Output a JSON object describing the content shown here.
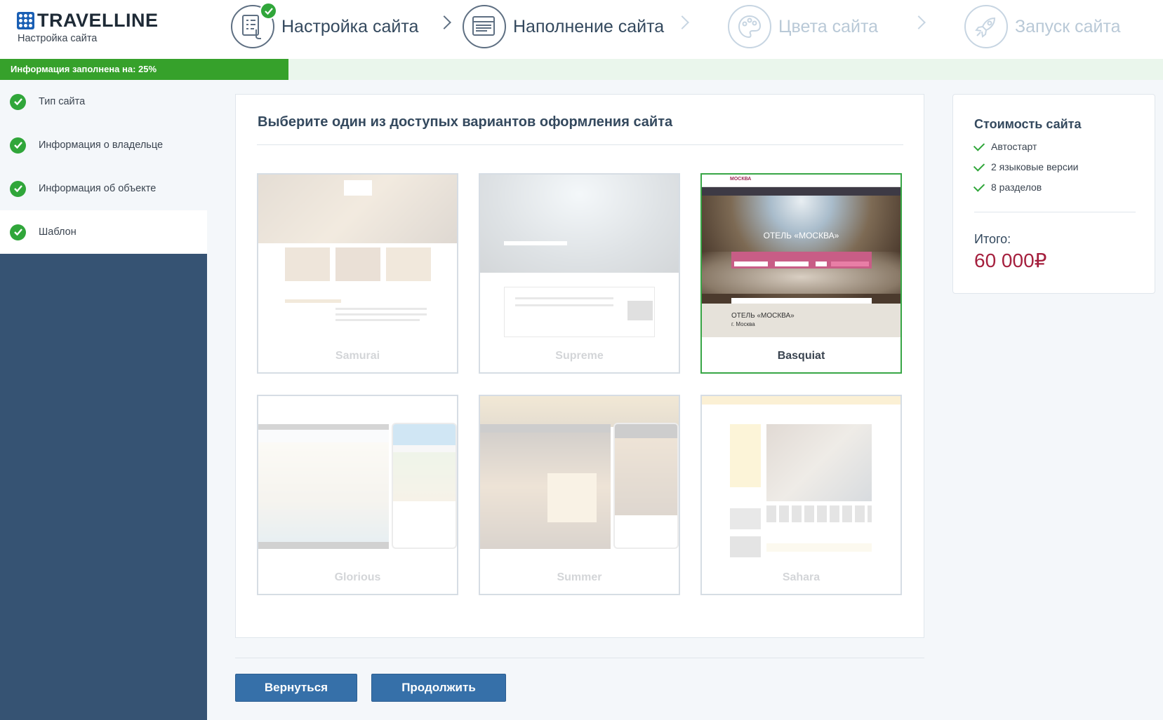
{
  "header": {
    "brand": "TRAVELLINE",
    "subtitle": "Настройка сайта",
    "steps": [
      {
        "label": "Настройка сайта",
        "icon": "checklist-icon",
        "state": "done"
      },
      {
        "label": "Наполнение сайта",
        "icon": "browser-page-icon",
        "state": "active"
      },
      {
        "label": "Цвета сайта",
        "icon": "palette-icon",
        "state": "future"
      },
      {
        "label": "Запуск сайта",
        "icon": "rocket-icon",
        "state": "future"
      }
    ]
  },
  "progress": {
    "label": "Информация заполнена на: 25%",
    "percent": 25,
    "color": "#36a12b"
  },
  "sidebar": {
    "items": [
      {
        "label": "Тип сайта",
        "done": true
      },
      {
        "label": "Информация о владельце",
        "done": true
      },
      {
        "label": "Информация об объекте",
        "done": true
      },
      {
        "label": "Шаблон",
        "done": true,
        "current": true
      }
    ]
  },
  "main": {
    "title": "Выберите один из доступых вариантов оформления сайта",
    "templates": [
      {
        "name": "Samurai",
        "selected": false
      },
      {
        "name": "Supreme",
        "selected": false
      },
      {
        "name": "Basquiat",
        "selected": true,
        "preview": {
          "logo": "МОСКВА",
          "hero_title": "ОТЕЛЬ «МОСКВА»",
          "caption_title": "ОТЕЛЬ «МОСКВА»",
          "caption_city": "г. Москва"
        }
      },
      {
        "name": "Glorious",
        "selected": false
      },
      {
        "name": "Summer",
        "selected": false
      },
      {
        "name": "Sahara",
        "selected": false
      }
    ]
  },
  "summary": {
    "title": "Стоимость сайта",
    "features": [
      "Автостарт",
      "2 языковые версии",
      "8 разделов"
    ],
    "total_label": "Итого:",
    "total_value": "60 000₽"
  },
  "footer": {
    "back_label": "Вернуться",
    "continue_label": "Продолжить"
  },
  "colors": {
    "accent": "#3670a9",
    "success": "#30a63a",
    "sidebar": "#365373",
    "price": "#a5203e"
  }
}
